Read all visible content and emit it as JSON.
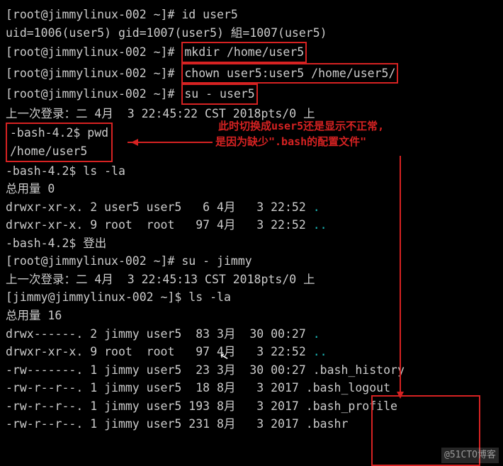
{
  "lines": {
    "l1_prompt": "[root@jimmylinux-002 ~]# ",
    "l1_cmd": "id user5",
    "l2": "uid=1006(user5) gid=1007(user5) 組=1007(user5)",
    "l3_prompt": "[root@jimmylinux-002 ~]# ",
    "l3_cmd": "mkdir /home/user5",
    "l4_prompt": "[root@jimmylinux-002 ~]# ",
    "l4_cmd": "chown user5:user5 /home/user5/",
    "l5_prompt": "[root@jimmylinux-002 ~]# ",
    "l5_cmd": "su - user5",
    "l6": "上一次登录：二 4月  3 22:45:22 CST 2018pts/0 上",
    "l7": "-bash-4.2$ pwd",
    "l8": "/home/user5",
    "l9": "-bash-4.2$ ls -la",
    "l10": "总用量 0",
    "l11": "drwxr-xr-x. 2 user5 user5   6 4月   3 22:52 ",
    "l11_dot": ".",
    "l12": "drwxr-xr-x. 9 root  root   97 4月   3 22:52 ",
    "l12_dot": "..",
    "l13": "-bash-4.2$ 登出",
    "l14_prompt": "[root@jimmylinux-002 ~]# ",
    "l14_cmd": "su - jimmy",
    "l15": "上一次登录：二 4月  3 22:45:13 CST 2018pts/0 上",
    "l16_prompt": "[jimmy@jimmylinux-002 ~]$ ",
    "l16_cmd": "ls -la",
    "l17": "总用量 16",
    "l18": "drwx------. 2 jimmy user5  83 3月  30 00:27 ",
    "l18_dot": ".",
    "l19": "drwxr-xr-x. 9 root  root   97 4月   3 22:52 ",
    "l19_dot": "..",
    "l20": "-rw-------. 1 jimmy user5  23 3月  30 00:27 ",
    "l20_f": ".bash_history",
    "l21": "-rw-r--r--. 1 jimmy user5  18 8月   3 2017 ",
    "l21_f": ".bash_logout",
    "l22": "-rw-r--r--. 1 jimmy user5 193 8月   3 2017 ",
    "l22_f": ".bash_profile",
    "l23": "-rw-r--r--. 1 jimmy user5 231 8月   3 2017 ",
    "l23_f": ".bashr"
  },
  "annotation": {
    "line1": "此时切换成user5还是显示不正常,",
    "line2": "是因为缺少\".bash的配置文件\""
  },
  "watermark": "@51CTO博客"
}
